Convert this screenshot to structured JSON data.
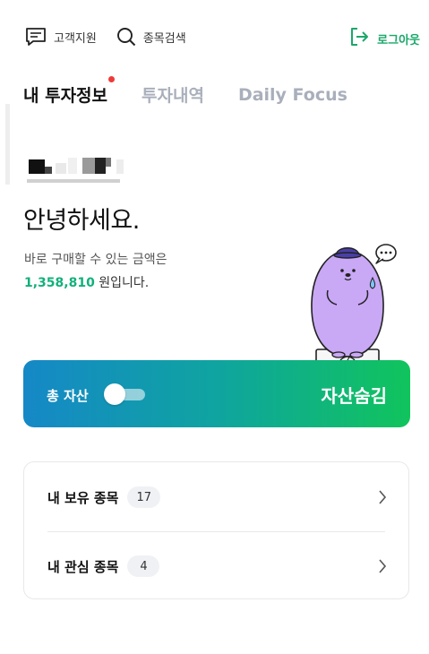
{
  "topbar": {
    "support_label": "고객지원",
    "search_label": "종목검색",
    "logout_label": "로그아웃"
  },
  "tabs": [
    {
      "label": "내 투자정보",
      "active": true,
      "has_notification": true
    },
    {
      "label": "투자내역",
      "active": false
    },
    {
      "label": "Daily Focus",
      "active": false
    }
  ],
  "greeting": {
    "title": "안녕하세요.",
    "available_text": "바로 구매할 수 있는 금액은",
    "amount": "1,358,810",
    "amount_suffix": "원입니다."
  },
  "asset_card": {
    "label": "총 자산",
    "toggle_on": false,
    "hide_label": "자산숨김",
    "gradient_start": "#1588c7",
    "gradient_end": "#10c45c"
  },
  "holdings": [
    {
      "label": "내 보유 종목",
      "count": "17"
    },
    {
      "label": "내 관심 종목",
      "count": "4"
    }
  ],
  "colors": {
    "accent_green": "#13b07a",
    "notification_red": "#ee3a3a",
    "tab_inactive": "#a9afbb",
    "mascot_purple": "#c9a8f5"
  }
}
